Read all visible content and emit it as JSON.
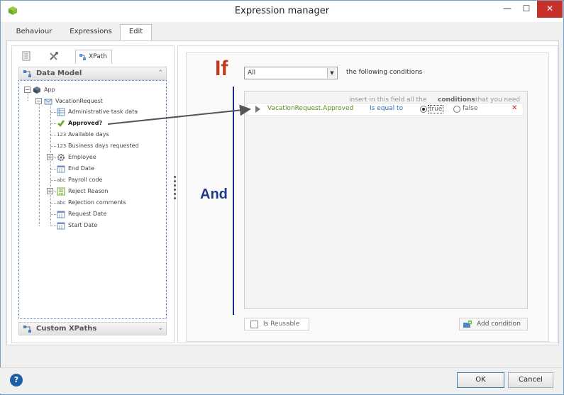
{
  "window": {
    "title": "Expression manager",
    "minimize": "—",
    "maximize": "☐",
    "close": "✕"
  },
  "tabs": [
    {
      "label": "Behaviour",
      "active": false
    },
    {
      "label": "Expressions",
      "active": false
    },
    {
      "label": "Edit",
      "active": true
    }
  ],
  "left_panel": {
    "tool_tabs": [
      {
        "icon": "document-icon"
      },
      {
        "icon": "tools-icon"
      },
      {
        "label": "XPath",
        "icon": "xpath-icon",
        "active": true
      }
    ],
    "data_model_header": "Data Model",
    "custom_xpaths_header": "Custom XPaths",
    "tree": {
      "root": "App",
      "entity": "VacationRequest",
      "items": [
        {
          "type": "",
          "label": "Administrative task data",
          "icon": "grid-icon"
        },
        {
          "type": "",
          "label": "Approved?",
          "icon": "check-icon",
          "bold": true
        },
        {
          "type": "123",
          "label": "Available days"
        },
        {
          "type": "123",
          "label": "Business days requested"
        },
        {
          "type": "",
          "label": "Employee",
          "icon": "gear-icon",
          "expandable": true
        },
        {
          "type": "",
          "label": "End Date",
          "icon": "calendar-icon"
        },
        {
          "type": "abc",
          "label": "Payroll code"
        },
        {
          "type": "",
          "label": "Reject Reason",
          "icon": "list-icon",
          "expandable": true
        },
        {
          "type": "abc",
          "label": "Rejection comments"
        },
        {
          "type": "",
          "label": "Request Date",
          "icon": "calendar-icon"
        },
        {
          "type": "",
          "label": "Start Date",
          "icon": "calendar-icon"
        }
      ]
    }
  },
  "editor": {
    "if_label": "If",
    "and_label": "And",
    "match_select": "All",
    "following_text": "the following conditions",
    "hint_parts": [
      "insert in this field all the",
      "conditions",
      "that you need"
    ],
    "condition": {
      "field": "VacationRequest.Approved",
      "operator": "Is equal to",
      "true_label": "true",
      "false_label": "false",
      "selected": "true",
      "remove": "✕"
    },
    "reusable_label": "Is Reusable",
    "add_condition_label": "Add condition"
  },
  "footer": {
    "help": "?",
    "ok": "OK",
    "cancel": "Cancel"
  },
  "colors": {
    "if": "#c0391b",
    "and": "#1f3a8a",
    "field": "#5a8c1a",
    "operator": "#2a6cb6",
    "close": "#c7312b"
  }
}
